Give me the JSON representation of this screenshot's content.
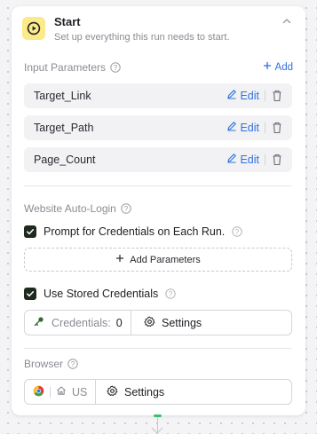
{
  "node": {
    "title": "Start",
    "subtitle": "Set up everything this run needs to start.",
    "icon": "play-circle-icon",
    "accent_color": "#fbe98a"
  },
  "input_parameters": {
    "label": "Input Parameters",
    "add_label": "Add",
    "edit_label": "Edit",
    "items": [
      {
        "name": "Target_Link"
      },
      {
        "name": "Target_Path"
      },
      {
        "name": "Page_Count"
      }
    ]
  },
  "auto_login": {
    "label": "Website Auto-Login",
    "prompt_credentials": {
      "label": "Prompt for Credentials on Each Run.",
      "checked": true
    },
    "add_parameters_label": "Add Parameters",
    "stored_credentials": {
      "label": "Use Stored Credentials",
      "checked": true
    },
    "credentials_label": "Credentials:",
    "credentials_count": "0",
    "settings_label": "Settings"
  },
  "browser": {
    "label": "Browser",
    "region": "US",
    "settings_label": "Settings"
  },
  "colors": {
    "link_blue": "#2f6fdf",
    "checkbox_dark": "#1f2a1e",
    "connector_green": "#3bbf6a"
  }
}
